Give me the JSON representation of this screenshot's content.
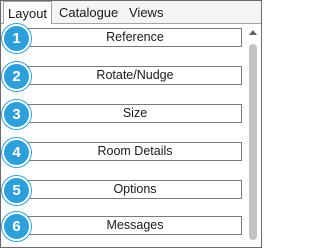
{
  "tabs": [
    {
      "label": "Layout",
      "active": true
    },
    {
      "label": "Catalogue",
      "active": false
    },
    {
      "label": "Views",
      "active": false
    }
  ],
  "buttons": [
    {
      "number": "1",
      "label": "Reference"
    },
    {
      "number": "2",
      "label": "Rotate/Nudge"
    },
    {
      "number": "3",
      "label": "Size"
    },
    {
      "number": "4",
      "label": "Room Details"
    },
    {
      "number": "5",
      "label": "Options"
    },
    {
      "number": "6",
      "label": "Messages"
    }
  ],
  "colors": {
    "badge": "#2e9fd9",
    "frame_border": "#6b6b6b"
  },
  "icons": {
    "scroll_up": "chevron-up-icon"
  }
}
